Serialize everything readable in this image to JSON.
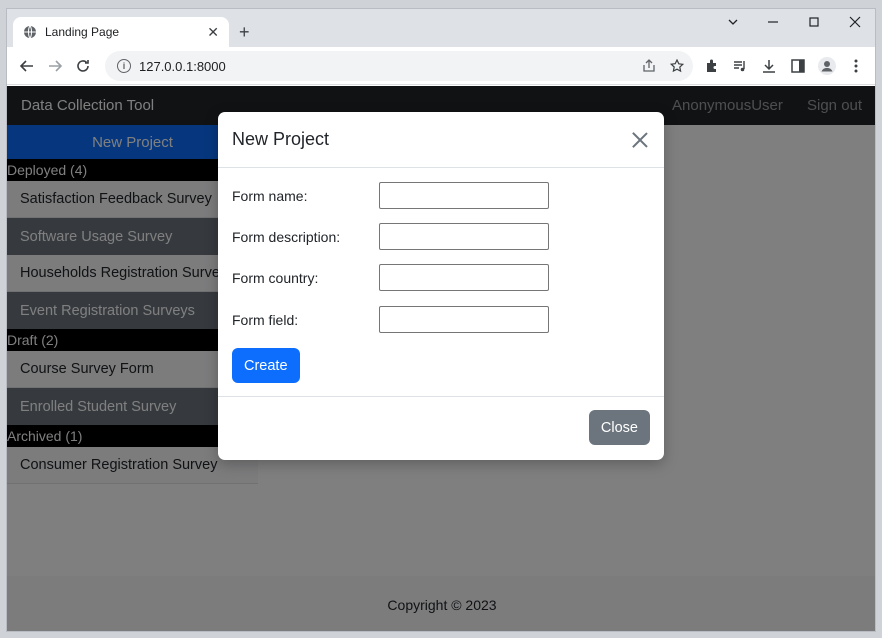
{
  "browser": {
    "tab_title": "Landing Page",
    "url": "127.0.0.1:8000",
    "icons": [
      "globe-icon",
      "close-icon",
      "plus-icon",
      "chevron-down-icon",
      "minimize-icon",
      "maximize-icon",
      "window-close-icon",
      "back-icon",
      "forward-icon",
      "reload-icon",
      "info-icon",
      "share-icon",
      "star-icon",
      "extensions-icon",
      "media-icon",
      "download-icon",
      "side-panel-icon",
      "profile-icon",
      "menu-icon"
    ]
  },
  "navbar": {
    "brand": "Data Collection Tool",
    "user": "AnonymousUser",
    "signout": "Sign out"
  },
  "sidebar": {
    "new_project": "New Project",
    "groups": [
      {
        "header": "Deployed (4)",
        "items": [
          "Satisfaction Feedback Survey",
          "Software Usage Survey",
          "Households Registration Survey",
          "Event Registration Surveys"
        ]
      },
      {
        "header": "Draft (2)",
        "items": [
          "Course Survey Form",
          "Enrolled Student Survey"
        ]
      },
      {
        "header": "Archived (1)",
        "items": [
          "Consumer Registration Survey"
        ]
      }
    ]
  },
  "modal": {
    "title": "New Project",
    "fields": [
      {
        "label": "Form name:",
        "value": ""
      },
      {
        "label": "Form description:",
        "value": ""
      },
      {
        "label": "Form country:",
        "value": ""
      },
      {
        "label": "Form field:",
        "value": ""
      }
    ],
    "create_label": "Create",
    "close_label": "Close"
  },
  "footer": {
    "text": "Copyright © 2023"
  },
  "colors": {
    "primary": "#0d6efd",
    "secondary": "#6c757d",
    "dark": "#212529"
  }
}
